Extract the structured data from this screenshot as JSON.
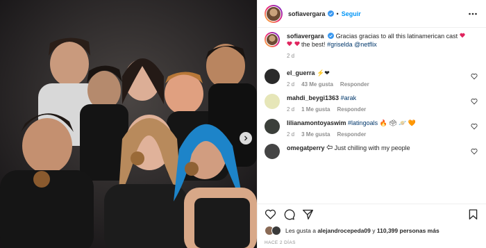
{
  "post": {
    "username": "sofiavergara",
    "follow_label": "Seguir",
    "dot": "•",
    "caption": {
      "username": "sofiavergara",
      "text_before": "Gracias gracias to all this latinamerican cast",
      "text_after": "the best!",
      "hashtag": "#griselda",
      "mention": "@netflix",
      "time": "2 d"
    },
    "comments": [
      {
        "username": "el_guerra",
        "emoji_text": "⚡❤",
        "time": "2 d",
        "likes": "43 Me gusta",
        "reply": "Responder",
        "avatar_color": "#2a2a2a"
      },
      {
        "username": "mahdi_beygi1363",
        "hashtag": "#arak",
        "time": "2 d",
        "likes": "1 Me gusta",
        "reply": "Responder",
        "avatar_color": "#e6e6b8"
      },
      {
        "username": "lilianamontoyaswim",
        "hashtag": "#latingoals",
        "emoji_text": "🔥 🗳 🪐 🧡",
        "time": "2 d",
        "likes": "3 Me gusta",
        "reply": "Responder",
        "avatar_color": "#3b3f3a"
      },
      {
        "username": "omegatperry",
        "text": "Just chilling with my people",
        "time": "",
        "avatar_color": "#444"
      }
    ],
    "likes_line": {
      "prefix": "Les gusta a",
      "user": "alejandrocepeda09",
      "conj": "y",
      "count": "110,399",
      "suffix": "personas más"
    },
    "date_label": "HACE 2 DÍAS"
  },
  "colors": {
    "accent": "#0095f6",
    "text": "#262626",
    "muted": "#8e8e8e",
    "like_red": "#ed4956"
  },
  "icons": [
    "more-icon",
    "heart-icon",
    "comment-icon",
    "share-icon",
    "save-icon",
    "verified-icon",
    "chevron-right-icon"
  ]
}
